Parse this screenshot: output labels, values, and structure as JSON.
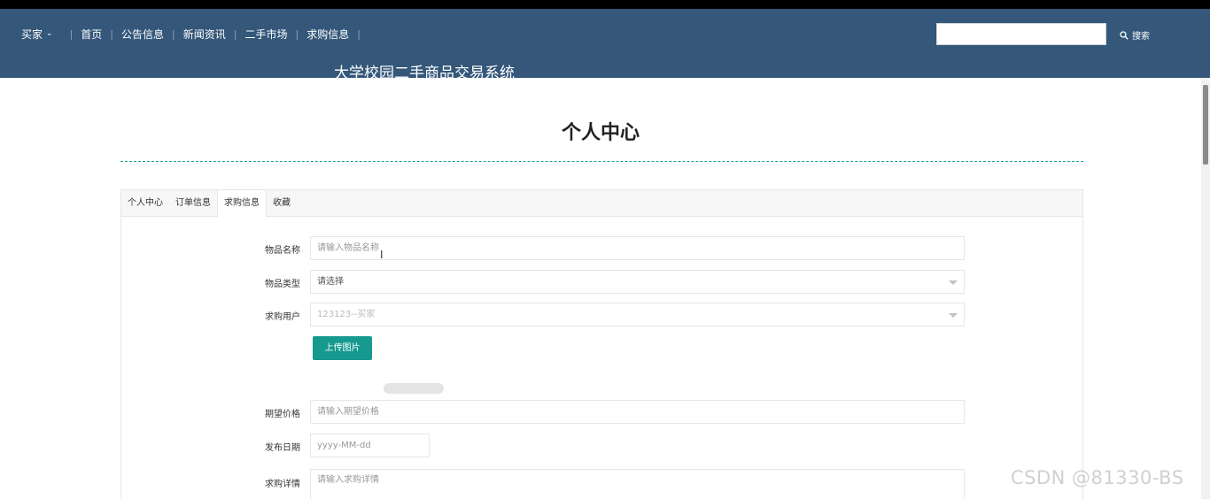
{
  "nav": {
    "role_label": "买家",
    "items": [
      "首页",
      "公告信息",
      "新闻资讯",
      "二手市场",
      "求购信息"
    ]
  },
  "search": {
    "button_label": "搜索",
    "placeholder": ""
  },
  "site_title": "大学校园二手商品交易系统",
  "page_title": "个人中心",
  "tabs": [
    {
      "label": "个人中心",
      "active": false
    },
    {
      "label": "订单信息",
      "active": false
    },
    {
      "label": "求购信息",
      "active": true
    },
    {
      "label": "收藏",
      "active": false
    }
  ],
  "form": {
    "item_name": {
      "label": "物品名称",
      "placeholder": "请输入物品名称"
    },
    "item_type": {
      "label": "物品类型",
      "value": "请选择"
    },
    "buyer_user": {
      "label": "求购用户",
      "value": "123123--买家"
    },
    "upload_label": "上传图片",
    "expected_price": {
      "label": "期望价格",
      "placeholder": "请输入期望价格"
    },
    "publish_date": {
      "label": "发布日期",
      "placeholder": "yyyy-MM-dd"
    },
    "details": {
      "label": "求购详情",
      "placeholder": "请输入求购详情"
    }
  },
  "watermark": "CSDN @81330-BS",
  "colors": {
    "header_bg": "#34577a",
    "accent": "#169a8f",
    "dash_line": "#1aa094"
  }
}
